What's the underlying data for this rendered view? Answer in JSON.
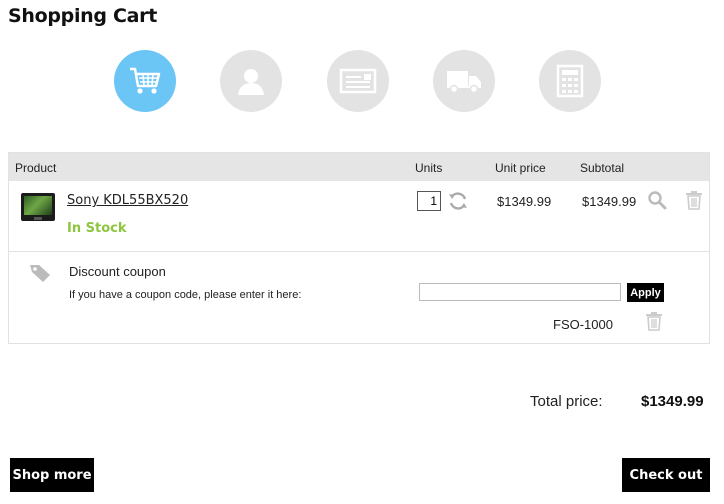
{
  "page": {
    "title": "Shopping Cart"
  },
  "steps": [
    {
      "icon": "cart-icon",
      "active": true
    },
    {
      "icon": "user-icon",
      "active": false
    },
    {
      "icon": "address-card-icon",
      "active": false
    },
    {
      "icon": "truck-icon",
      "active": false
    },
    {
      "icon": "calculator-icon",
      "active": false
    }
  ],
  "colors": {
    "active_step": "#6cc6f5",
    "inactive_step": "#e3e3e3",
    "in_stock": "#8cc63f",
    "header_bg": "#e5e5e5"
  },
  "table": {
    "headers": {
      "product": "Product",
      "units": "Units",
      "unit_price": "Unit price",
      "subtotal": "Subtotal"
    },
    "item": {
      "name": "Sony KDL55BX520",
      "stock": "In Stock",
      "quantity": "1",
      "unit_price": "$1349.99",
      "subtotal": "$1349.99"
    }
  },
  "coupon": {
    "title": "Discount coupon",
    "description": "If you have a coupon code, please enter it here:",
    "input_value": "",
    "apply_label": "Apply",
    "applied_code": "FSO-1000"
  },
  "summary": {
    "total_label": "Total price:",
    "total_value": "$1349.99"
  },
  "actions": {
    "shop_more": "Shop more",
    "check_out": "Check out"
  }
}
